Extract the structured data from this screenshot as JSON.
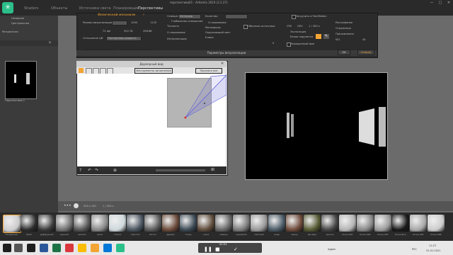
{
  "app": {
    "title": "перспектива01 - Artlantis 2019 (2.2.27)"
  },
  "tabs": [
    {
      "label": "Shaders"
    },
    {
      "label": "Объекты"
    },
    {
      "label": "Источники света"
    },
    {
      "label": "Планировщик"
    },
    {
      "label": "Перспективы"
    }
  ],
  "sidebar": {
    "header": "Perspectives",
    "field1": "Название",
    "field2": "Центральная",
    "item_label": "Перспектива 1"
  },
  "settings": {
    "title": "Параметры визуализации",
    "engine_label": "Физический механизм",
    "render_size_label": "Размер визуализации",
    "size_w": "1000",
    "size_h": "1125",
    "dpi": "72 dpi",
    "w_mm": "352.78",
    "h_mm": "396.88",
    "ratio_label": "Отношение ЦИ",
    "ratio_value": "Постоянная скорость",
    "rendering_label": "Освещение",
    "rendering_value": "Интерьер",
    "quality_label": "Качество",
    "global_illum": "Глобальное освещение",
    "accuracy": "Точность",
    "smoothing": "Сглаживание",
    "materials": "Материалы",
    "interpolation": "Интерполяция",
    "ambient": "Окружающий свет",
    "reflections": "Блики",
    "diffusion": "Рассеивание",
    "reflection_light": "Отражения",
    "refractions": "Преломления",
    "antialias_label": "Обычные источники",
    "send_to": "Загрузить в TwinMotion",
    "cpu": "CPU",
    "gpu": "GPU",
    "frames": "1 / 300 s",
    "exposure": "Экспозиция",
    "blank_light": "Белая подсветка",
    "iso": "ISO",
    "sky_label": "Упрощенный фон",
    "value_40": "40",
    "value_0": "0",
    "apply_button": "Применить типовые",
    "save_button": "Задать как типовые",
    "ok_button": "OK",
    "cancel_button": "Отмена"
  },
  "dynamic": {
    "title": "Двумерный вид",
    "tool_label": "Инструменты заполнения",
    "show_all": "Показать все"
  },
  "viewport": {
    "size_left": "500 x 281",
    "frames": "1 / 300 s"
  },
  "materials": [
    {
      "label": "Полупрозр",
      "color": "#cccccc"
    },
    {
      "label": "Paint",
      "color": "#2d2d2d"
    },
    {
      "label": "диффузный",
      "color": "#3a3a3a"
    },
    {
      "label": "зеркало",
      "color": "#707070"
    },
    {
      "label": "металл",
      "color": "#555555"
    },
    {
      "label": "хром",
      "color": "#888888"
    },
    {
      "label": "стекло",
      "color": "#cfd8dc"
    },
    {
      "label": "пластик",
      "color": "#4a5560"
    },
    {
      "label": "бетон",
      "color": "#5a5a5a"
    },
    {
      "label": "дерево",
      "color": "#6a4a3a"
    },
    {
      "label": "ткань",
      "color": "#3c4a55"
    },
    {
      "label": "кожа",
      "color": "#5e4b3b"
    },
    {
      "label": "камень",
      "color": "#666666"
    },
    {
      "label": "керамика",
      "color": "#7a7a7a"
    },
    {
      "label": "светлый",
      "color": "#999999"
    },
    {
      "label": "вода",
      "color": "#4b5b66"
    },
    {
      "label": "эмаль",
      "color": "#6e4a3a"
    },
    {
      "label": "фосфор",
      "color": "#555a33"
    },
    {
      "label": "краска",
      "color": "#444444"
    },
    {
      "label": "Кожа 001",
      "color": "#b5b5b5"
    },
    {
      "label": "Кожа 002",
      "color": "#888888"
    },
    {
      "label": "Кожа 003",
      "color": "#9a9a9a"
    },
    {
      "label": "Кожа фон",
      "color": "#1a1a1a"
    },
    {
      "label": "Кожа 005",
      "color": "#a8a8a8"
    },
    {
      "label": "Кожа 006",
      "color": "#cccccc"
    }
  ],
  "player": {
    "time": "02:53"
  },
  "taskbar": {
    "lang": "РУС",
    "time": "11:27",
    "date": "31.01.2021",
    "search_placeholder": "Адрес"
  },
  "colors": {
    "accent": "#f2a535",
    "tab_active": "#3a8fd6",
    "brand": "#2bbf8a"
  }
}
